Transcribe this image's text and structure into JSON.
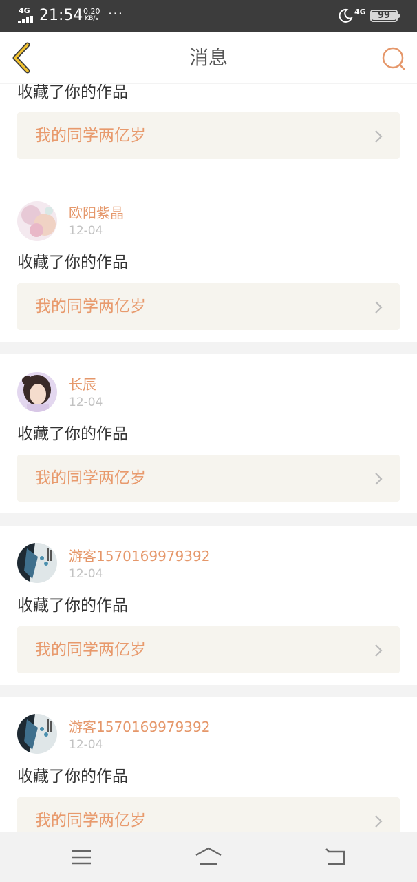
{
  "status_bar": {
    "network": "4G",
    "time": "21:54",
    "speed_value": "0.20",
    "speed_unit": "KB/s",
    "more": "···",
    "network2": "4G",
    "battery": "99"
  },
  "header": {
    "title": "消息",
    "back_icon": "chevron-left-icon",
    "search_icon": "search-icon"
  },
  "colors": {
    "accent": "#e5976a",
    "back_accent": "#f2c230",
    "card_bg": "#f6f4ee",
    "page_bg": "#f3f3f3"
  },
  "messages": [
    {
      "action": "收藏了你的作品",
      "work_title": "我的同学两亿岁"
    },
    {
      "user": "欧阳紫晶",
      "date": "12-04",
      "action": "收藏了你的作品",
      "work_title": "我的同学两亿岁"
    },
    {
      "user": "长辰",
      "date": "12-04",
      "action": "收藏了你的作品",
      "work_title": "我的同学两亿岁"
    },
    {
      "user": "游客1570169979392",
      "date": "12-04",
      "action": "收藏了你的作品",
      "work_title": "我的同学两亿岁"
    },
    {
      "user": "游客1570169979392",
      "date": "12-04",
      "action": "收藏了你的作品",
      "work_title": "我的同学两亿岁"
    }
  ],
  "navbar": {
    "menu_icon": "menu-icon",
    "home_icon": "home-icon",
    "back_icon": "back-icon"
  }
}
